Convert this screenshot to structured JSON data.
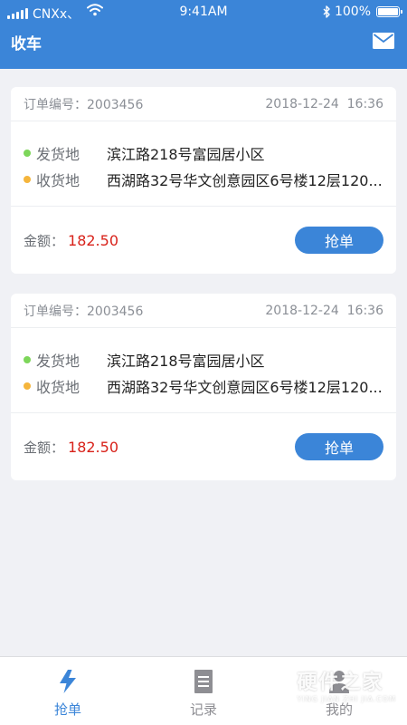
{
  "status_bar": {
    "carrier": "CNXx、",
    "time": "9:41AM",
    "battery": "100%"
  },
  "nav": {
    "title": "收车",
    "mail_icon": "mail-icon"
  },
  "orders": [
    {
      "order_label": "订单编号：",
      "order_no": "2003456",
      "date": "2018-12-24  16:36",
      "from_label": "发货地",
      "from_value": "滨江路218号富园居小区",
      "to_label": "收货地",
      "to_value": "西湖路32号华文创意园区6号楼12层120...",
      "amount_label": "金额：",
      "amount_value": "182.50",
      "action_label": "抢单"
    },
    {
      "order_label": "订单编号：",
      "order_no": "2003456",
      "date": "2018-12-24  16:36",
      "from_label": "发货地",
      "from_value": "滨江路218号富园居小区",
      "to_label": "收货地",
      "to_value": "西湖路32号华文创意园区6号楼12层120...",
      "amount_label": "金额：",
      "amount_value": "182.50",
      "action_label": "抢单"
    }
  ],
  "tabs": [
    {
      "label": "抢单",
      "icon": "lightning-icon",
      "active": true
    },
    {
      "label": "记录",
      "icon": "document-icon",
      "active": false
    },
    {
      "label": "我的",
      "icon": "user-icon",
      "active": false
    }
  ],
  "watermark": {
    "main": "硬件之家",
    "sub": "YING JIAN ZHI JIA.COM"
  },
  "colors": {
    "primary": "#3b85d8",
    "from_dot": "#7dd65a",
    "to_dot": "#f5b53c",
    "amount": "#d8221a",
    "background": "#f0f1f5"
  }
}
